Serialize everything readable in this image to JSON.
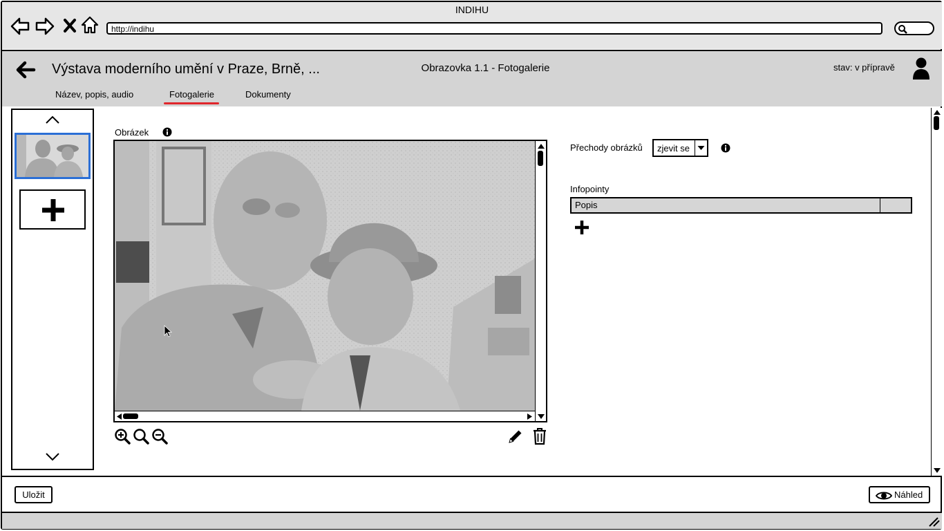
{
  "browser": {
    "window_title": "INDIHU",
    "url": "http://indihu"
  },
  "header": {
    "exhibition_title": "Výstava moderního umění v Praze, Brně, ...",
    "screen_name": "Obrazovka 1.1 - Fotogalerie",
    "status": "stav: v přípravě"
  },
  "tabs": [
    {
      "label": "Název, popis, audio",
      "active": false
    },
    {
      "label": "Fotogalerie",
      "active": true
    },
    {
      "label": "Dokumenty",
      "active": false
    }
  ],
  "image_section": {
    "label": "Obrázek"
  },
  "transitions": {
    "label": "Přechody obrázků",
    "selected": "zjevit se"
  },
  "infopoints": {
    "label": "Infopointy",
    "columns": [
      "Popis",
      ""
    ]
  },
  "footer": {
    "save_label": "Uložit",
    "preview_label": "Náhled"
  },
  "colors": {
    "active_tab_underline": "#e0262b",
    "selected_thumbnail_border": "#2b6fd6"
  }
}
